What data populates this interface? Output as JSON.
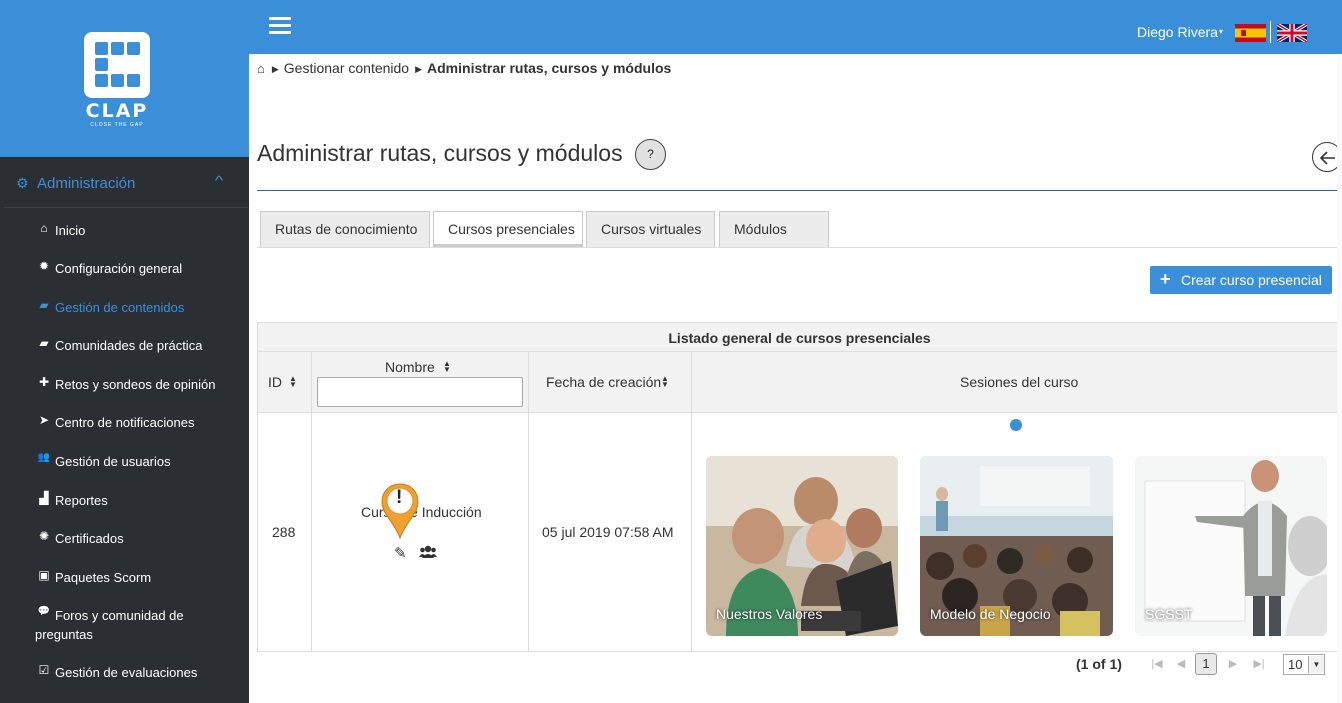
{
  "app": {
    "logo_text": "CLAP",
    "logo_subtext": "CLOSE THE GAP",
    "brand_color": "#3b8fd9",
    "sidebar_color": "#2b2f33"
  },
  "topbar": {
    "user_name": "Diego Rivera",
    "user_caret": "▾",
    "languages": [
      "es-flag-icon",
      "uk-flag-icon"
    ]
  },
  "sidebar": {
    "section_title": "Administración",
    "section_icon": "gears-icon",
    "items": [
      {
        "label": "Inicio",
        "icon": "home-icon",
        "glyph": "⌂",
        "active": false
      },
      {
        "label": "Configuración general",
        "icon": "gear-icon",
        "glyph": "✹",
        "active": false
      },
      {
        "label": "Gestión de contenidos",
        "icon": "book-icon",
        "glyph": "▰",
        "active": true
      },
      {
        "label": "Comunidades de práctica",
        "icon": "book-icon",
        "glyph": "▰",
        "active": false
      },
      {
        "label": "Retos y sondeos de opinión",
        "icon": "puzzle-icon",
        "glyph": "✚",
        "active": false
      },
      {
        "label": "Centro de notificaciones",
        "icon": "paper-plane-icon",
        "glyph": "➤",
        "active": false
      },
      {
        "label": "Gestión de usuarios",
        "icon": "users-icon",
        "glyph": "👥",
        "active": false
      },
      {
        "label": "Reportes",
        "icon": "area-chart-icon",
        "glyph": "▟",
        "active": false
      },
      {
        "label": "Certificados",
        "icon": "certificate-icon",
        "glyph": "✺",
        "active": false
      },
      {
        "label": "Paquetes Scorm",
        "icon": "archive-icon",
        "glyph": "▣",
        "active": false
      },
      {
        "label": "Foros y comunidad de preguntas",
        "icon": "comments-icon",
        "glyph": "💬",
        "active": false
      },
      {
        "label": "Gestión de evaluaciones",
        "icon": "check-square-icon",
        "glyph": "☑",
        "active": false
      }
    ]
  },
  "breadcrumb": {
    "home_icon": "home-icon",
    "items": [
      "Gestionar contenido",
      "Administrar rutas, cursos y módulos"
    ]
  },
  "page": {
    "title": "Administrar rutas, cursos y módulos",
    "help_label": "?",
    "back_icon": "arrow-left-circle-icon"
  },
  "tabs": [
    {
      "label": "Rutas de conocimiento",
      "active": false
    },
    {
      "label": "Cursos presenciales",
      "active": true
    },
    {
      "label": "Cursos virtuales",
      "active": false
    },
    {
      "label": "Módulos",
      "active": false
    }
  ],
  "create_button": {
    "icon": "plus-icon",
    "label": "Crear curso presencial"
  },
  "table": {
    "caption": "Listado general de cursos presenciales",
    "columns": [
      "ID",
      "Nombre",
      "Fecha de creación",
      "Sesiones del curso"
    ],
    "name_filter": {
      "value": "",
      "placeholder": ""
    },
    "rows": [
      {
        "id": "288",
        "name": "Curso de Inducción",
        "actions": [
          "pencil-icon",
          "users-icon"
        ],
        "created": "05 jul 2019 07:58 AM",
        "sessions": [
          "Nuestros Valores",
          "Modelo de Negocio",
          "SGSST"
        ]
      }
    ]
  },
  "pagination": {
    "summary": "(1 of 1)",
    "current_page": "1",
    "rows_per_page": "10"
  },
  "overlay": {
    "warning_marker": "!"
  }
}
